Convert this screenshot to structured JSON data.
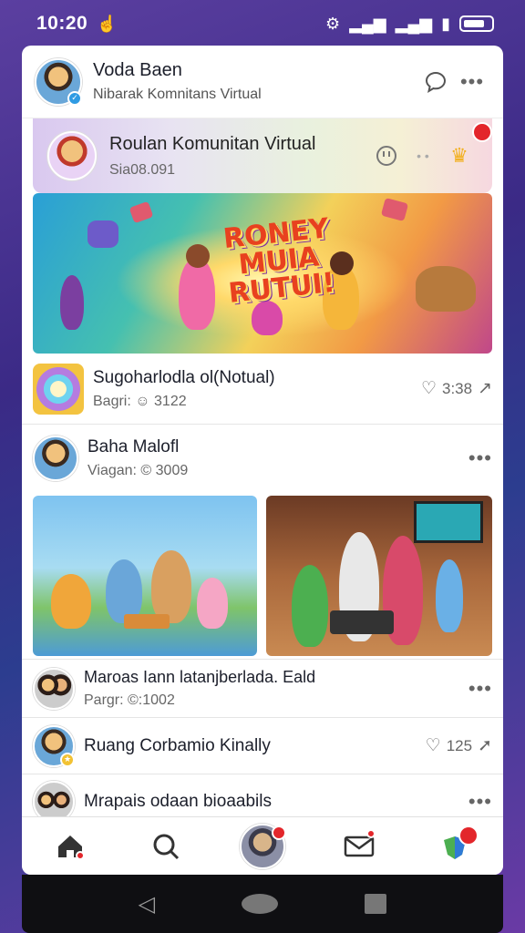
{
  "status": {
    "time": "10:20"
  },
  "header": {
    "name": "Voda Baen",
    "subtitle": "Nibarak Komnitans Virtual"
  },
  "community": {
    "title": "Roulan Komunitan Virtual",
    "subtitle": "Sia08.091"
  },
  "hero": {
    "title": "RONEY MUIA RUTUI!"
  },
  "posts": [
    {
      "name": "Sugoharlodla ol(Notual)",
      "sub": "Bagri: ☺ 3122",
      "stat": "3:38"
    },
    {
      "name": "Baha Malofl",
      "sub": "Viagan: © 3009"
    },
    {
      "name": "Maroas Iann latanjberlada. Eald",
      "sub": "Pargr: ©:1002"
    },
    {
      "name": "Ruang Corbamio Kinally",
      "stat": "125"
    },
    {
      "name": "Mrapais odaan bioaabils"
    }
  ],
  "icons": {
    "chat": "chat-bubble-icon",
    "more": "more-dots-icon",
    "nav": [
      "home-icon",
      "search-icon",
      "profile-icon",
      "mail-icon",
      "globe-icon"
    ]
  },
  "colors": {
    "accent": "#e3262b",
    "badge": "#2f9be3"
  }
}
